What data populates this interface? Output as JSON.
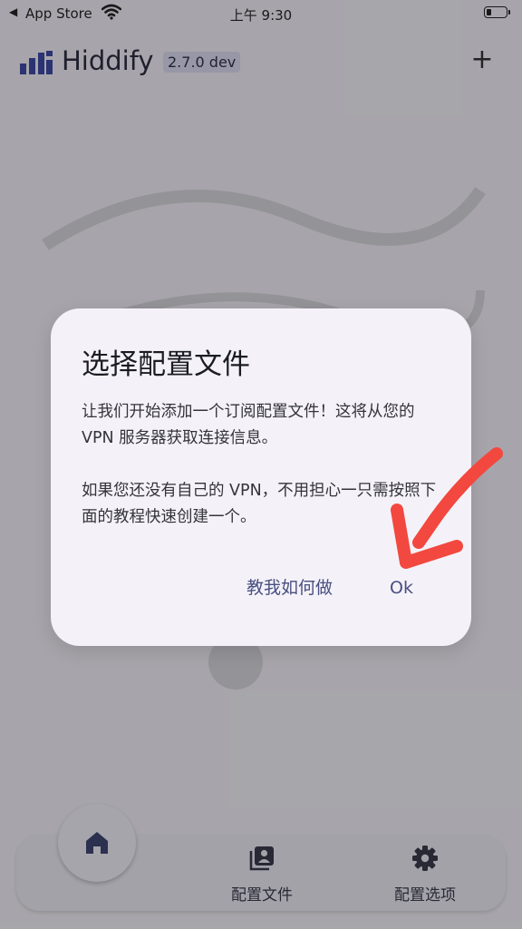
{
  "status_bar": {
    "back_label": "App Store",
    "time": "上午 9:30",
    "battery_level": 0.25
  },
  "app_bar": {
    "title": "Hiddify",
    "version": "2.7.0 dev",
    "add_icon": "plus-icon"
  },
  "dialog": {
    "title": "选择配置文件",
    "paragraphs": [
      "让我们开始添加一个订阅配置文件！这将从您的 VPN 服务器获取连接信息。",
      "如果您还没有自己的 VPN，不用担心一只需按照下面的教程快速创建一个。"
    ],
    "actions": {
      "howto": "教我如何做",
      "ok": "Ok"
    }
  },
  "bottom_nav": {
    "items": [
      {
        "icon": "home-icon",
        "label": ""
      },
      {
        "icon": "profiles-icon",
        "label": "配置文件"
      },
      {
        "icon": "gear-icon",
        "label": "配置选项"
      }
    ]
  },
  "colors": {
    "brand": "#2e3b9e",
    "dialog_bg": "#f4f2f8",
    "action_text": "#4a4f82",
    "annotation_arrow": "#f2483f"
  }
}
